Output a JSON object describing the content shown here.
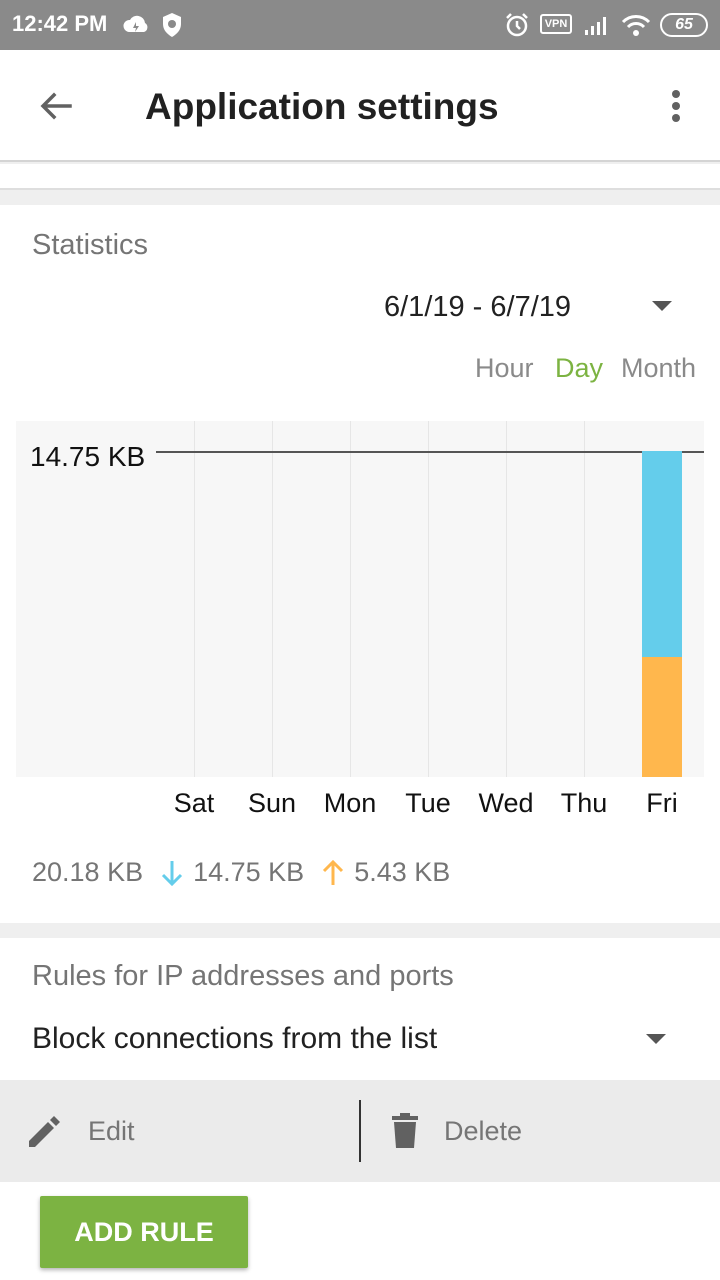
{
  "status_bar": {
    "time": "12:42 PM",
    "vpn_label": "VPN",
    "battery": "65",
    "icons": [
      "cloud-icon",
      "shield-icon",
      "alarm-icon",
      "vpn-icon",
      "signal-icon",
      "wifi-icon",
      "battery-icon"
    ]
  },
  "appbar": {
    "title": "Application settings",
    "icons": [
      "back-arrow-icon",
      "more-vert-icon"
    ]
  },
  "statistics": {
    "title": "Statistics",
    "date_range": "6/1/19 - 6/7/19",
    "periods": [
      "Hour",
      "Day",
      "Month"
    ],
    "active_period": "Day",
    "totals": {
      "total": "20.18 KB",
      "download": "14.75 KB",
      "upload": "5.43 KB"
    }
  },
  "chart_data": {
    "type": "bar",
    "stacked": true,
    "categories": [
      "Sat",
      "Sun",
      "Mon",
      "Tue",
      "Wed",
      "Thu",
      "Fri"
    ],
    "max_label": "14.75 KB",
    "ymax": 14.75,
    "series": [
      {
        "values": [
          0,
          0,
          0,
          0,
          0,
          0,
          5.43
        ],
        "color": "#ffb74d"
      },
      {
        "values": [
          0,
          0,
          0,
          0,
          0,
          0,
          9.32
        ],
        "color": "#64cdeb"
      }
    ]
  },
  "rules": {
    "title": "Rules for IP addresses and ports",
    "value": "Block connections from the list"
  },
  "actions": {
    "edit_label": "Edit",
    "delete_label": "Delete"
  },
  "add_rule_label": "ADD RULE",
  "colors": {
    "accent": "#7cb342",
    "download": "#64cdeb",
    "upload": "#ffb74d",
    "status_bar": "#8a8a8a"
  }
}
